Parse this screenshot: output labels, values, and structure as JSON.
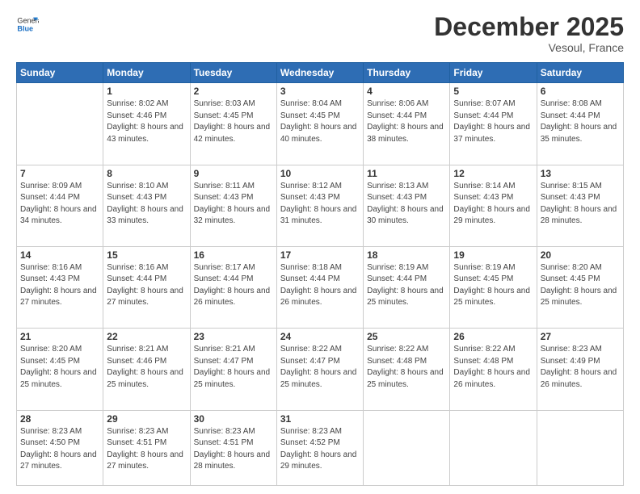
{
  "header": {
    "logo_general": "General",
    "logo_blue": "Blue",
    "title": "December 2025",
    "location": "Vesoul, France"
  },
  "days_of_week": [
    "Sunday",
    "Monday",
    "Tuesday",
    "Wednesday",
    "Thursday",
    "Friday",
    "Saturday"
  ],
  "weeks": [
    [
      {
        "day": "",
        "info": ""
      },
      {
        "day": "1",
        "info": "Sunrise: 8:02 AM\nSunset: 4:46 PM\nDaylight: 8 hours\nand 43 minutes."
      },
      {
        "day": "2",
        "info": "Sunrise: 8:03 AM\nSunset: 4:45 PM\nDaylight: 8 hours\nand 42 minutes."
      },
      {
        "day": "3",
        "info": "Sunrise: 8:04 AM\nSunset: 4:45 PM\nDaylight: 8 hours\nand 40 minutes."
      },
      {
        "day": "4",
        "info": "Sunrise: 8:06 AM\nSunset: 4:44 PM\nDaylight: 8 hours\nand 38 minutes."
      },
      {
        "day": "5",
        "info": "Sunrise: 8:07 AM\nSunset: 4:44 PM\nDaylight: 8 hours\nand 37 minutes."
      },
      {
        "day": "6",
        "info": "Sunrise: 8:08 AM\nSunset: 4:44 PM\nDaylight: 8 hours\nand 35 minutes."
      }
    ],
    [
      {
        "day": "7",
        "info": "Sunrise: 8:09 AM\nSunset: 4:44 PM\nDaylight: 8 hours\nand 34 minutes."
      },
      {
        "day": "8",
        "info": "Sunrise: 8:10 AM\nSunset: 4:43 PM\nDaylight: 8 hours\nand 33 minutes."
      },
      {
        "day": "9",
        "info": "Sunrise: 8:11 AM\nSunset: 4:43 PM\nDaylight: 8 hours\nand 32 minutes."
      },
      {
        "day": "10",
        "info": "Sunrise: 8:12 AM\nSunset: 4:43 PM\nDaylight: 8 hours\nand 31 minutes."
      },
      {
        "day": "11",
        "info": "Sunrise: 8:13 AM\nSunset: 4:43 PM\nDaylight: 8 hours\nand 30 minutes."
      },
      {
        "day": "12",
        "info": "Sunrise: 8:14 AM\nSunset: 4:43 PM\nDaylight: 8 hours\nand 29 minutes."
      },
      {
        "day": "13",
        "info": "Sunrise: 8:15 AM\nSunset: 4:43 PM\nDaylight: 8 hours\nand 28 minutes."
      }
    ],
    [
      {
        "day": "14",
        "info": "Sunrise: 8:16 AM\nSunset: 4:43 PM\nDaylight: 8 hours\nand 27 minutes."
      },
      {
        "day": "15",
        "info": "Sunrise: 8:16 AM\nSunset: 4:44 PM\nDaylight: 8 hours\nand 27 minutes."
      },
      {
        "day": "16",
        "info": "Sunrise: 8:17 AM\nSunset: 4:44 PM\nDaylight: 8 hours\nand 26 minutes."
      },
      {
        "day": "17",
        "info": "Sunrise: 8:18 AM\nSunset: 4:44 PM\nDaylight: 8 hours\nand 26 minutes."
      },
      {
        "day": "18",
        "info": "Sunrise: 8:19 AM\nSunset: 4:44 PM\nDaylight: 8 hours\nand 25 minutes."
      },
      {
        "day": "19",
        "info": "Sunrise: 8:19 AM\nSunset: 4:45 PM\nDaylight: 8 hours\nand 25 minutes."
      },
      {
        "day": "20",
        "info": "Sunrise: 8:20 AM\nSunset: 4:45 PM\nDaylight: 8 hours\nand 25 minutes."
      }
    ],
    [
      {
        "day": "21",
        "info": "Sunrise: 8:20 AM\nSunset: 4:45 PM\nDaylight: 8 hours\nand 25 minutes."
      },
      {
        "day": "22",
        "info": "Sunrise: 8:21 AM\nSunset: 4:46 PM\nDaylight: 8 hours\nand 25 minutes."
      },
      {
        "day": "23",
        "info": "Sunrise: 8:21 AM\nSunset: 4:47 PM\nDaylight: 8 hours\nand 25 minutes."
      },
      {
        "day": "24",
        "info": "Sunrise: 8:22 AM\nSunset: 4:47 PM\nDaylight: 8 hours\nand 25 minutes."
      },
      {
        "day": "25",
        "info": "Sunrise: 8:22 AM\nSunset: 4:48 PM\nDaylight: 8 hours\nand 25 minutes."
      },
      {
        "day": "26",
        "info": "Sunrise: 8:22 AM\nSunset: 4:48 PM\nDaylight: 8 hours\nand 26 minutes."
      },
      {
        "day": "27",
        "info": "Sunrise: 8:23 AM\nSunset: 4:49 PM\nDaylight: 8 hours\nand 26 minutes."
      }
    ],
    [
      {
        "day": "28",
        "info": "Sunrise: 8:23 AM\nSunset: 4:50 PM\nDaylight: 8 hours\nand 27 minutes."
      },
      {
        "day": "29",
        "info": "Sunrise: 8:23 AM\nSunset: 4:51 PM\nDaylight: 8 hours\nand 27 minutes."
      },
      {
        "day": "30",
        "info": "Sunrise: 8:23 AM\nSunset: 4:51 PM\nDaylight: 8 hours\nand 28 minutes."
      },
      {
        "day": "31",
        "info": "Sunrise: 8:23 AM\nSunset: 4:52 PM\nDaylight: 8 hours\nand 29 minutes."
      },
      {
        "day": "",
        "info": ""
      },
      {
        "day": "",
        "info": ""
      },
      {
        "day": "",
        "info": ""
      }
    ]
  ]
}
